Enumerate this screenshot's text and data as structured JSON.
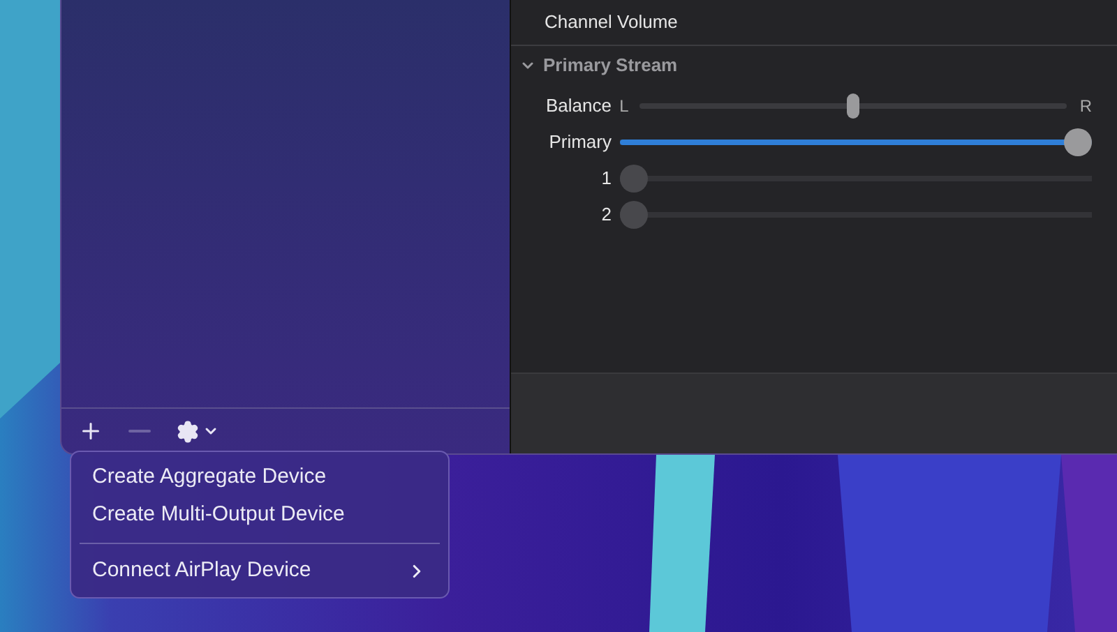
{
  "detail_pane": {
    "header": "Channel Volume",
    "section": {
      "title": "Primary Stream",
      "expanded": true
    },
    "balance": {
      "label": "Balance",
      "left": "L",
      "right": "R",
      "level": 0.5
    },
    "channels": [
      {
        "label": "Primary",
        "level": 1.0,
        "kind": "main"
      },
      {
        "label": "1",
        "level": 0.0,
        "kind": "channel"
      },
      {
        "label": "2",
        "level": 0.0,
        "kind": "channel"
      }
    ]
  },
  "sidebar_toolbar": [
    {
      "kind": "add",
      "disabled": false
    },
    {
      "kind": "remove",
      "disabled": true
    },
    {
      "kind": "action",
      "disabled": false
    }
  ],
  "menu": {
    "groups": [
      [
        {
          "label": "Create Aggregate Device",
          "submenu": false
        },
        {
          "label": "Create Multi-Output Device",
          "submenu": false
        }
      ],
      [
        {
          "label": "Connect AirPlay Device",
          "submenu": true
        }
      ]
    ]
  }
}
